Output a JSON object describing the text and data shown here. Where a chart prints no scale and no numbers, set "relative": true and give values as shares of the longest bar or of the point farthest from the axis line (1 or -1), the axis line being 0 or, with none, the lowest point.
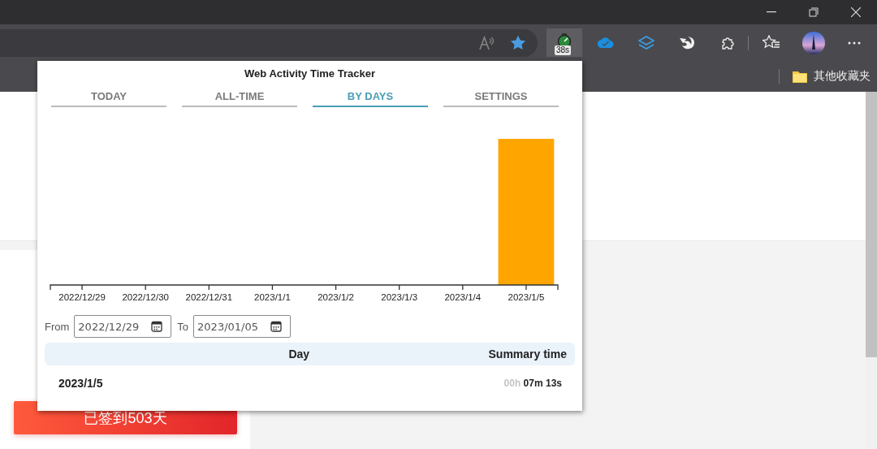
{
  "toolbar": {
    "extension_badge": "38s"
  },
  "bookmarks": [
    {
      "label": "其他收藏夹"
    }
  ],
  "popup": {
    "title": "Web Activity Time Tracker",
    "tabs": [
      {
        "label": "TODAY",
        "selected": false
      },
      {
        "label": "ALL-TIME",
        "selected": false
      },
      {
        "label": "BY DAYS",
        "selected": true
      },
      {
        "label": "SETTINGS",
        "selected": false
      }
    ],
    "chart_data": {
      "type": "bar",
      "categories": [
        "2022/12/29",
        "2022/12/30",
        "2022/12/31",
        "2023/1/1",
        "2023/1/2",
        "2023/1/3",
        "2023/1/4",
        "2023/1/5"
      ],
      "relative": true,
      "series": [
        {
          "color": "#ffa500",
          "values": [
            0,
            0,
            0,
            0,
            0,
            0,
            0,
            1
          ]
        }
      ]
    },
    "filter": {
      "from_label": "From",
      "from_value": "2022/12/29",
      "to_label": "To",
      "to_value": "2023/01/05"
    },
    "table": {
      "columns": [
        "Day",
        "Summary time"
      ],
      "rows": [
        {
          "day": "2023/1/5",
          "hours": "00h",
          "rest": "07m 13s"
        }
      ]
    }
  },
  "page": {
    "checkin_button": "已签到503天"
  }
}
